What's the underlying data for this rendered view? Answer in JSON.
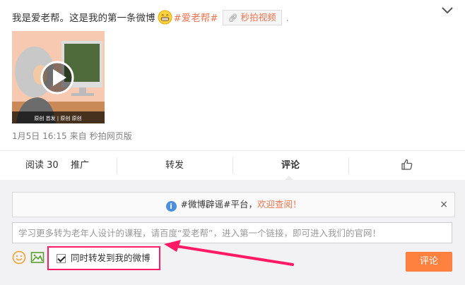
{
  "post": {
    "text": "我是爱老帮。这是我的第一条微博",
    "topic": "#爱老帮#",
    "video_tag_icon": "link-icon",
    "video_tag_label": "秒拍视频",
    "trailing": ".",
    "video_caption": "原创 首发 | 原创 原创",
    "time": "1月5日 16:15",
    "source_prefix": "来自",
    "source": "秒拍网页版"
  },
  "actions": {
    "read_label": "阅读 30",
    "promote_label": "推广",
    "repost_label": "转发",
    "comment_label": "评论",
    "like_icon": "thumbs-up-icon"
  },
  "comment": {
    "notice_prefix": "#微博辟谣#平台，",
    "notice_link": "欢迎查阅！",
    "notice_close": "×",
    "input_value": "学习更多转为老年人设计的课程，请百度“爱老帮”，进入第一个链接，即可进入我们的官网！",
    "repost_checkbox_label": "同时转发到我的微博",
    "repost_checked": true,
    "submit_label": "评论"
  },
  "colors": {
    "accent": "#eb7350",
    "submit_bg": "#ff8140",
    "highlight": "#ff1a66",
    "info_blue": "#4a90e2"
  }
}
